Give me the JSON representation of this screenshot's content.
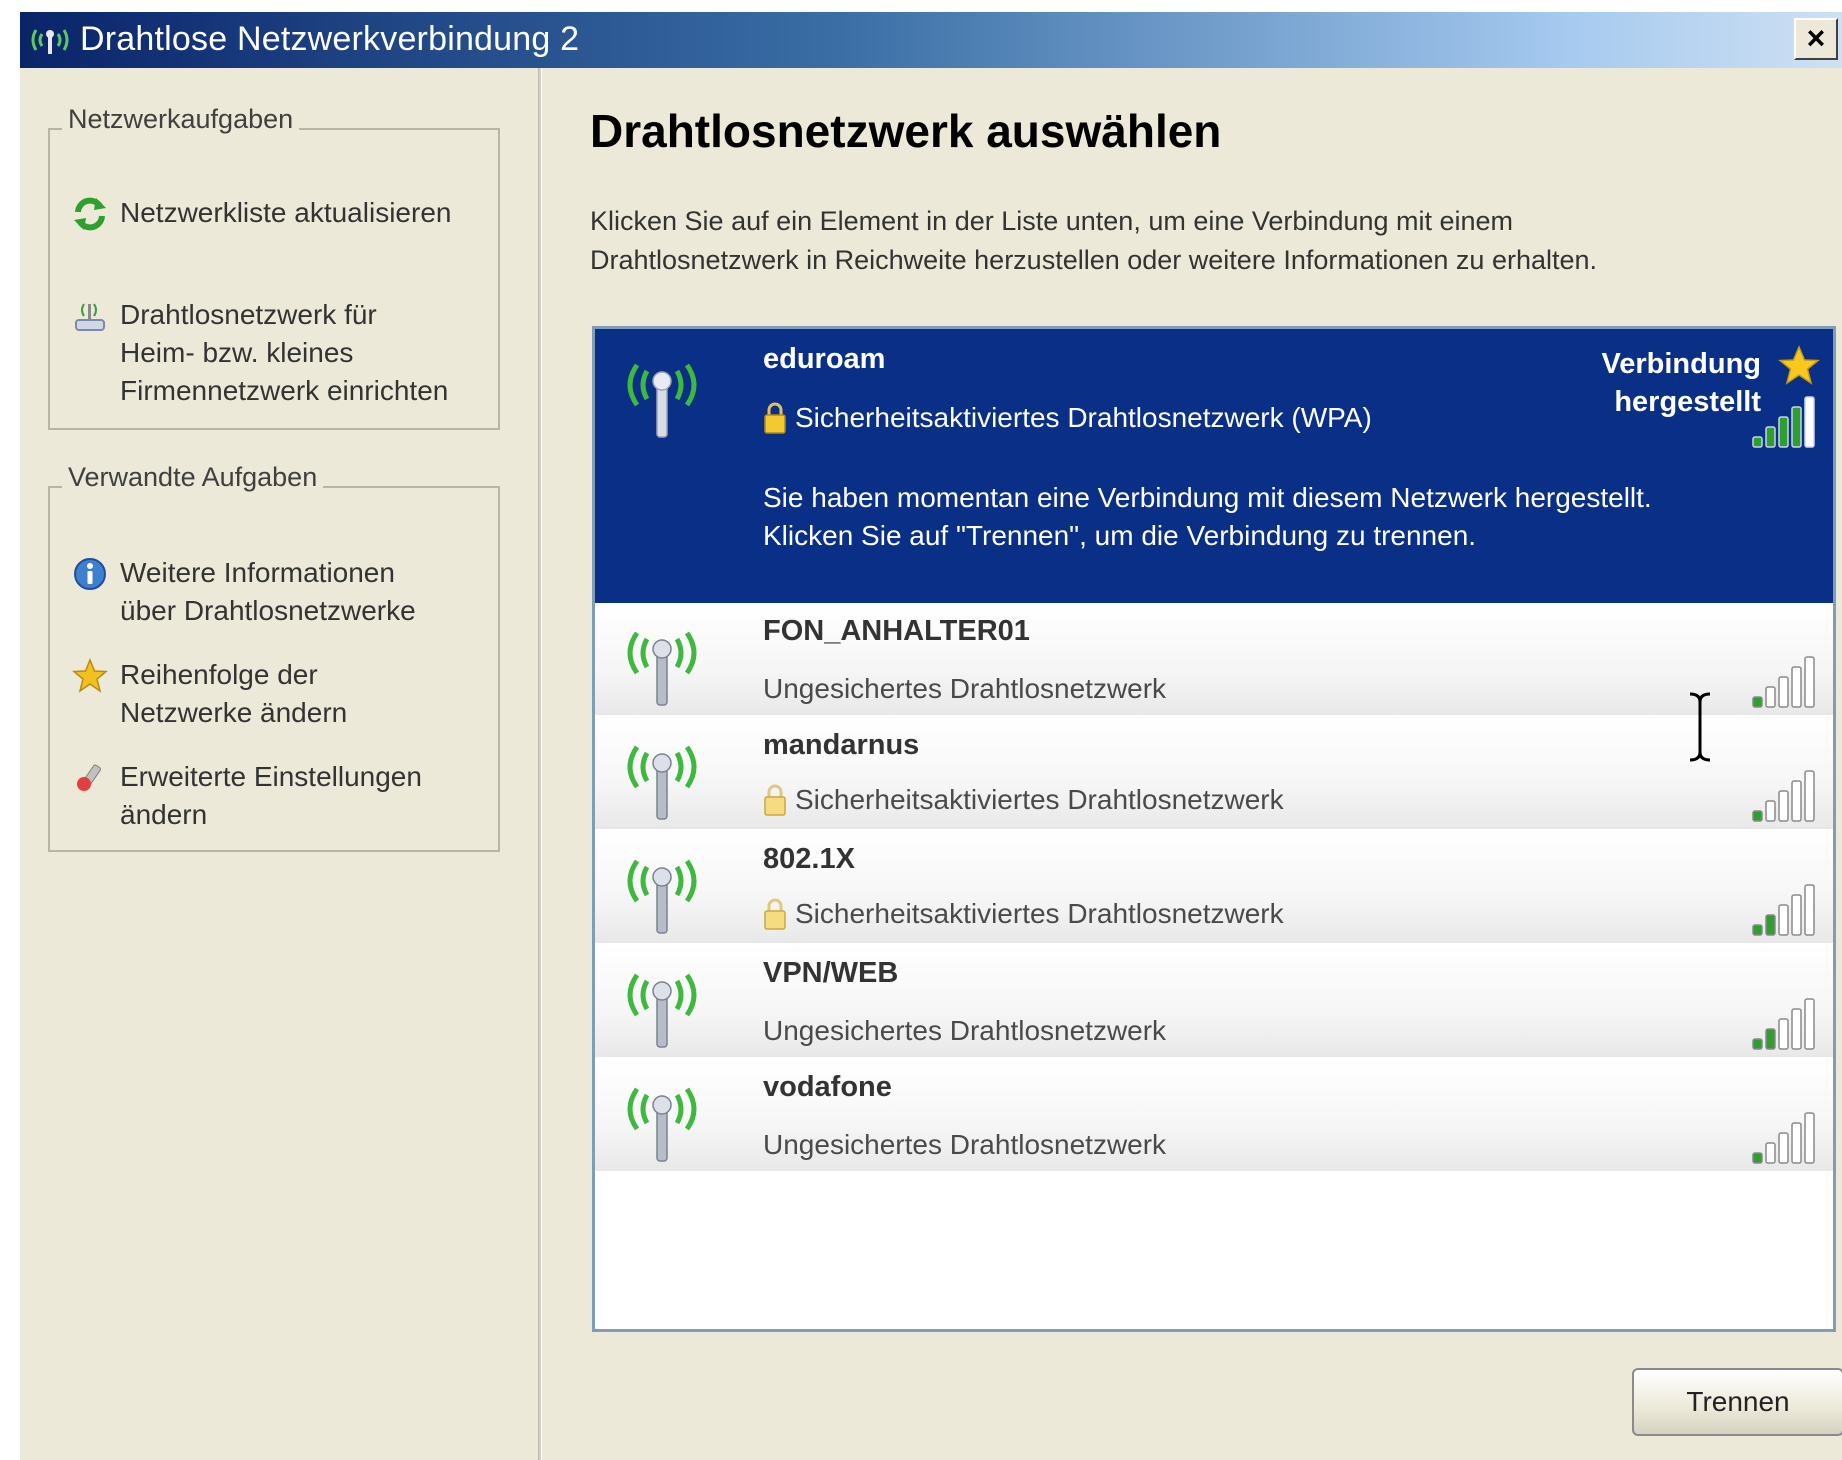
{
  "window": {
    "title": "Drahtlose Netzwerkverbindung 2",
    "close_label": "×"
  },
  "sidebar": {
    "network_tasks": {
      "title": "Netzwerkaufgaben",
      "items": [
        {
          "label": "Netzwerkliste aktualisieren",
          "icon": "refresh-icon"
        },
        {
          "label": "Drahtlosnetzwerk für\nHeim- bzw. kleines\nFirmennetzwerk einrichten",
          "icon": "wireless-setup-icon"
        }
      ]
    },
    "related_tasks": {
      "title": "Verwandte Aufgaben",
      "items": [
        {
          "label": "Weitere Informationen\nüber Drahtlosnetzwerke",
          "icon": "info-icon"
        },
        {
          "label": "Reihenfolge der\nNetzwerke ändern",
          "icon": "star-icon"
        },
        {
          "label": "Erweiterte Einstellungen\nändern",
          "icon": "settings-icon"
        }
      ]
    }
  },
  "main": {
    "heading": "Drahtlosnetzwerk auswählen",
    "instructions": "Klicken Sie auf ein Element in der Liste unten, um eine Verbindung mit einem\nDrahtlosnetzwerk in Reichweite herzustellen oder weitere Informationen zu erhalten.",
    "networks": [
      {
        "ssid": "eduroam",
        "security": "Sicherheitsaktiviertes Drahtlosnetzwerk (WPA)",
        "secured": true,
        "selected": true,
        "status": "Verbindung\nhergestellt",
        "description": "Sie haben momentan eine Verbindung mit diesem Netzwerk hergestellt.\nKlicken Sie auf \"Trennen\", um die Verbindung zu trennen.",
        "signal_bars": 4
      },
      {
        "ssid": "FON_ANHALTER01",
        "security": "Ungesichertes Drahtlosnetzwerk",
        "secured": false,
        "selected": false,
        "signal_bars": 1
      },
      {
        "ssid": "mandarnus",
        "security": "Sicherheitsaktiviertes Drahtlosnetzwerk",
        "secured": true,
        "selected": false,
        "signal_bars": 1
      },
      {
        "ssid": "802.1X",
        "security": "Sicherheitsaktiviertes Drahtlosnetzwerk",
        "secured": true,
        "selected": false,
        "signal_bars": 2
      },
      {
        "ssid": "VPN/WEB",
        "security": "Ungesichertes Drahtlosnetzwerk",
        "secured": false,
        "selected": false,
        "signal_bars": 2
      },
      {
        "ssid": "vodafone",
        "security": "Ungesichertes Drahtlosnetzwerk",
        "secured": false,
        "selected": false,
        "signal_bars": 1
      }
    ],
    "disconnect_button": "Trennen"
  },
  "colors": {
    "selected_row": "#0a2f86",
    "title_bar_start": "#0a246a",
    "antenna_waves": "#2fa82f",
    "signal_active": "#2e9e2e"
  }
}
